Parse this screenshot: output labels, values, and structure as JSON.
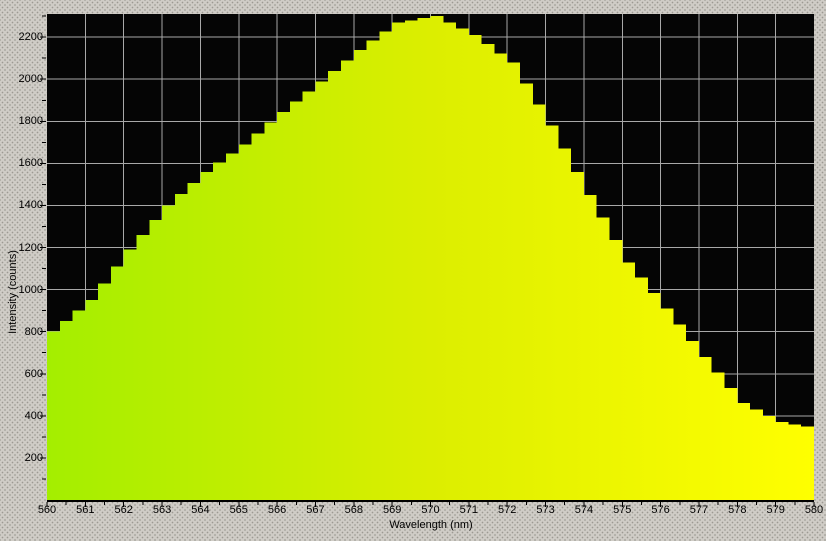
{
  "chart": {
    "xlabel": "Wavelength (nm)",
    "ylabel": "Intensity (counts)"
  },
  "chart_data": {
    "type": "area",
    "title": "",
    "xlabel": "Wavelength (nm)",
    "ylabel": "Intensity (counts)",
    "xlim": [
      560,
      580
    ],
    "ylim": [
      0,
      2310
    ],
    "x_major_tick": 1,
    "x_minor_tick": 0.5,
    "y_major_tick": 200,
    "y_minor_tick": 100,
    "x_tick_labels": [
      560,
      561,
      562,
      563,
      564,
      565,
      566,
      567,
      568,
      569,
      570,
      571,
      572,
      573,
      574,
      575,
      576,
      577,
      578,
      579,
      580
    ],
    "y_tick_labels": [
      200,
      400,
      600,
      800,
      1000,
      1200,
      1400,
      1600,
      1800,
      2000,
      2200
    ],
    "grid": true,
    "legend": "none",
    "x": [
      560,
      561,
      562,
      563,
      564,
      565,
      566,
      567,
      568,
      569,
      570,
      571,
      572,
      573,
      574,
      575,
      576,
      577,
      578,
      579,
      580
    ],
    "values": [
      800,
      950,
      1190,
      1400,
      1560,
      1690,
      1845,
      1990,
      2140,
      2270,
      2300,
      2210,
      2080,
      1780,
      1450,
      1130,
      910,
      680,
      460,
      370,
      340
    ],
    "peak": {
      "x": 570,
      "value": 2300
    },
    "render_step_nm": 0.3333,
    "style": {
      "plot_bg": "#050505",
      "grid_color": "#a8a8a8",
      "axis_color": "#000000",
      "text_color": "#000000",
      "page_bg": "#cfccc6",
      "page_dot": "#9d9a93",
      "fill_gradient": [
        {
          "at": 560,
          "color": "#a4ee00"
        },
        {
          "at": 570,
          "color": "#dcee00"
        },
        {
          "at": 580,
          "color": "#ffff00"
        }
      ]
    }
  }
}
